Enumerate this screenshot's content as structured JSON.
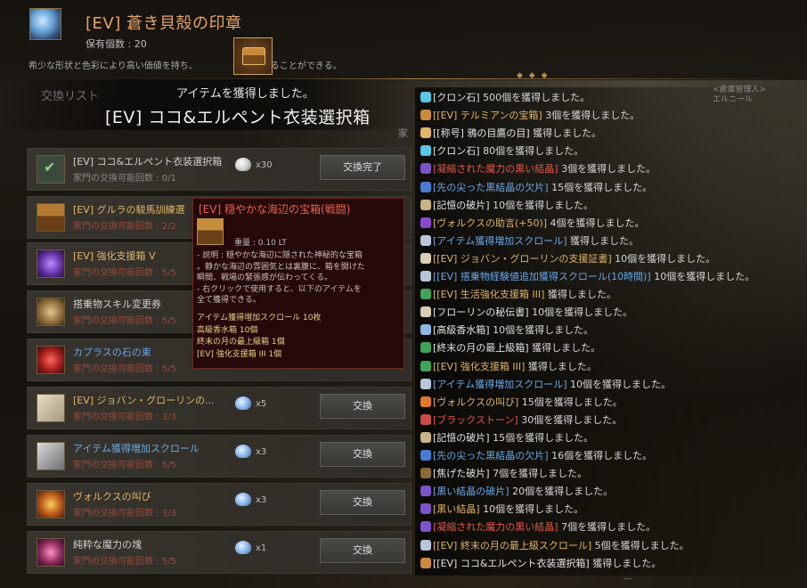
{
  "header": {
    "title": "[EV] 蒼き貝殻の印章",
    "owned": "保有個数 : 20",
    "description": "希少な形状と色彩により高い価値を持ち、",
    "description_tail": "交換することができる。"
  },
  "acquired": {
    "message": "アイテムを獲得しました。",
    "item_name": "[EV] ココ&エルペント衣装選択箱"
  },
  "exchange_list": {
    "title": "交換リスト",
    "family_hint": "家",
    "rows": [
      {
        "name": "[EV] ココ&エルペント衣装選択箱",
        "sub": "家門の交換可能回数 : 0/1",
        "qty": "x30",
        "button": "交換完了",
        "icon": "check-icon"
      },
      {
        "name": "[EV] グルラの駿馬訓練選",
        "sub": "家門の交換可能回数 : 2/2",
        "qty": "",
        "button": "",
        "icon": "chest-icon"
      },
      {
        "name": "[EV] 強化支援箱 V",
        "sub": "家門の交換可能回数 : 5/5",
        "qty": "",
        "button": "",
        "icon": "purple-box-icon"
      },
      {
        "name": "搭乗物スキル変更券",
        "sub": "家門の交換可能回数 : 5/5",
        "qty": "",
        "button": "",
        "icon": "coupon-icon"
      },
      {
        "name": "カプラスの石の束",
        "sub": "家門の交換可能回数 : 5/5",
        "qty": "",
        "button": "",
        "icon": "red-stone-icon"
      },
      {
        "name": "[EV] ジョバン・グローリンの...",
        "sub": "家門の交換可能回数 : 3/3",
        "qty": "x5",
        "button": "交換",
        "icon": "certificate-icon"
      },
      {
        "name": "アイテム獲得増加スクロール",
        "sub": "家門の交換可能回数 : 5/5",
        "qty": "x3",
        "button": "交換",
        "icon": "scroll-icon"
      },
      {
        "name": "ヴォルクスの叫び",
        "sub": "家門の交換可能回数 : 3/3",
        "qty": "x3",
        "button": "交換",
        "icon": "vorx-cry-icon"
      },
      {
        "name": "純粋な魔力の塊",
        "sub": "家門の交換可能回数 : 5/5",
        "qty": "x1",
        "button": "交換",
        "icon": "magic-crystal-icon"
      }
    ]
  },
  "tooltip": {
    "name": "[EV] 穏やかな海辺の宝箱(戦闘)",
    "weight": "重量 : 0.10 LT",
    "desc_lines": [
      "- 説明 : 穏やかな海辺に隠された神秘的な宝箱",
      "。静かな海辺の雰囲気とは裏腹に、箱を開けた",
      "瞬間、戦場の緊張感が伝わってくる。",
      "- 右クリックで使用すると、以下のアイテムを",
      "全て獲得できる。"
    ],
    "contents": [
      "アイテム獲得増加スクロール 10枚",
      "高級香水箱 10個",
      "終末の月の最上級箱 1個",
      "[EV] 強化支援箱 III 1個"
    ]
  },
  "log": {
    "top_right_1": "<倉庫管理人>",
    "top_right_2": "エルニール",
    "lines": [
      {
        "item": "[クロン石]",
        "rest": " 500個を獲得しました。",
        "color": "white",
        "icon": "kron-stone-icon"
      },
      {
        "item": "[[EV] テルミアンの宝箱]",
        "rest": " 3個を獲得しました。",
        "color": "gold",
        "icon": "chest-icon"
      },
      {
        "item": "[[称号] 鴉の目鷹の目]",
        "rest": " 獲得しました。",
        "color": "white",
        "icon": "title-icon"
      },
      {
        "item": "[クロン石]",
        "rest": " 80個を獲得しました。",
        "color": "white",
        "icon": "kron-stone-icon"
      },
      {
        "item": "[凝縮された魔力の黒い結晶]",
        "rest": " 3個を獲得しました。",
        "color": "red",
        "icon": "crystal-icon"
      },
      {
        "item": "[先の尖った黒結晶の欠片]",
        "rest": " 15個を獲得しました。",
        "color": "blue",
        "icon": "shard-icon"
      },
      {
        "item": "[記憶の破片]",
        "rest": " 10個を獲得しました。",
        "color": "white",
        "icon": "memory-icon"
      },
      {
        "item": "[ヴォルクスの助言(+50)]",
        "rest": " 4個を獲得しました。",
        "color": "gold",
        "icon": "advice-icon"
      },
      {
        "item": "[アイテム獲得増加スクロール]",
        "rest": " 獲得しました。",
        "color": "blue",
        "icon": "scroll-icon"
      },
      {
        "item": "[[EV] ジョバン・グローリンの支援証書]",
        "rest": " 10個を獲得しました。",
        "color": "gold",
        "icon": "certificate-icon"
      },
      {
        "item": "[[EV] 搭乗物経験値追加獲得スクロール(10時間)]",
        "rest": " 10個を獲得しました。",
        "color": "blue",
        "icon": "scroll-icon"
      },
      {
        "item": "[[EV] 生活強化支援箱 III]",
        "rest": " 獲得しました。",
        "color": "gold",
        "icon": "box-icon"
      },
      {
        "item": "[フローリンの秘伝書]",
        "rest": " 10個を獲得しました。",
        "color": "white",
        "icon": "book-icon"
      },
      {
        "item": "[高級香水箱]",
        "rest": " 10個を獲得しました。",
        "color": "white",
        "icon": "perfume-icon"
      },
      {
        "item": "[終末の月の最上級箱]",
        "rest": " 獲得しました。",
        "color": "white",
        "icon": "box-icon"
      },
      {
        "item": "[[EV] 強化支援箱 III]",
        "rest": " 獲得しました。",
        "color": "gold",
        "icon": "box-icon"
      },
      {
        "item": "[アイテム獲得増加スクロール]",
        "rest": " 10個を獲得しました。",
        "color": "blue",
        "icon": "scroll-icon"
      },
      {
        "item": "[ヴォルクスの叫び]",
        "rest": " 15個を獲得しました。",
        "color": "gold",
        "icon": "vorx-cry-icon"
      },
      {
        "item": "[ブラックストーン]",
        "rest": " 30個を獲得しました。",
        "color": "red",
        "icon": "blackstone-icon"
      },
      {
        "item": "[記憶の破片]",
        "rest": " 15個を獲得しました。",
        "color": "white",
        "icon": "memory-icon"
      },
      {
        "item": "[先の尖った黒結晶の欠片]",
        "rest": " 16個を獲得しました。",
        "color": "blue",
        "icon": "shard-icon"
      },
      {
        "item": "[焦げた破片]",
        "rest": " 7個を獲得しました。",
        "color": "white",
        "icon": "burnt-shard-icon"
      },
      {
        "item": "[黒い結晶の破片]",
        "rest": " 20個を獲得しました。",
        "color": "blue",
        "icon": "crystal-icon"
      },
      {
        "item": "[黒い結晶]",
        "rest": " 10個を獲得しました。",
        "color": "gold",
        "icon": "crystal-icon"
      },
      {
        "item": "[凝縮された魔力の黒い結晶]",
        "rest": " 7個を獲得しました。",
        "color": "red",
        "icon": "crystal-icon"
      },
      {
        "item": "[[EV] 終末の月の最上級スクロール]",
        "rest": " 5個を獲得しました。",
        "color": "gold",
        "icon": "scroll-icon"
      },
      {
        "item": "[[EV] ココ&エルペント衣装選択箱]",
        "rest": " 獲得しました。",
        "color": "white",
        "icon": "chest-icon"
      }
    ],
    "bottom": "---"
  },
  "colors": {
    "accent": "#e6a46b",
    "gold_text": "#e0b46a",
    "blue_text": "#6aa7e8",
    "red_text": "#e2584d"
  }
}
